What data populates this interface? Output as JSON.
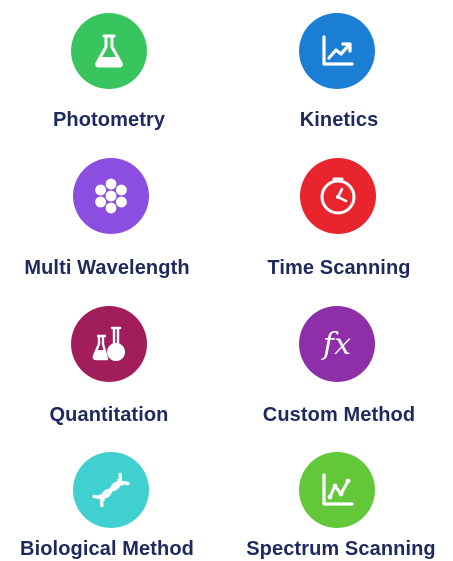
{
  "methods": [
    {
      "label": "Photometry",
      "icon": "flask-icon",
      "color": "#39c55e",
      "label_color": "#1e2a5e"
    },
    {
      "label": "Kinetics",
      "icon": "line-chart-icon",
      "color": "#1a7fd4",
      "label_color": "#1e2a5e"
    },
    {
      "label": "Multi Wavelength",
      "icon": "hexagon-cluster-icon",
      "color": "#8a4fe0",
      "label_color": "#1e2a5e"
    },
    {
      "label": "Time Scanning",
      "icon": "clock-icon",
      "color": "#e8242c",
      "label_color": "#1e2a5e"
    },
    {
      "label": "Quantitation",
      "icon": "lab-glassware-icon",
      "color": "#a21d5c",
      "label_color": "#1e2a5e"
    },
    {
      "label": "Custom Method",
      "icon": "function-fx-icon",
      "color": "#8e2ea8",
      "label_color": "#1e2a5e"
    },
    {
      "label": "Biological Method",
      "icon": "dna-icon",
      "color": "#3fd0cf",
      "label_color": "#1e2a5e"
    },
    {
      "label": "Spectrum Scanning",
      "icon": "spectrum-chart-icon",
      "color": "#63c73a",
      "label_color": "#1e2a5e"
    }
  ]
}
